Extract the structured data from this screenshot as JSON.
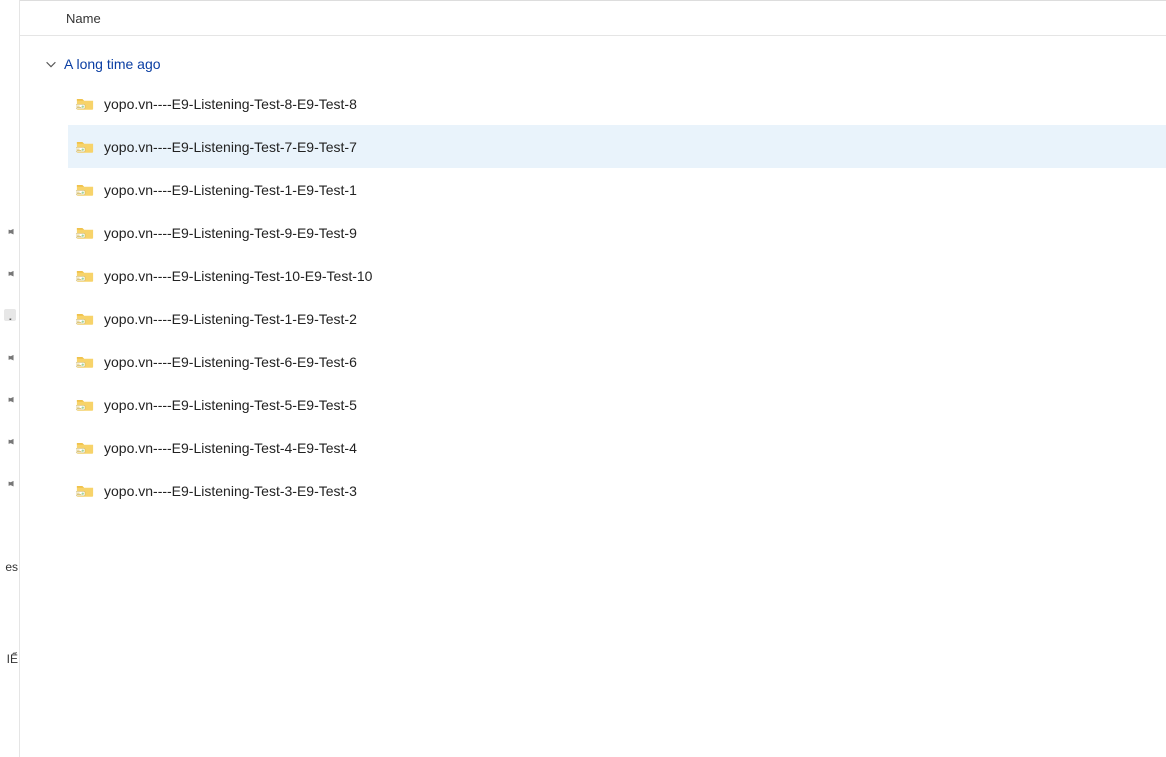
{
  "columns": {
    "name": "Name"
  },
  "group": {
    "label": "A long time ago",
    "expanded": true
  },
  "files": [
    {
      "name": "yopo.vn----E9-Listening-Test-8-E9-Test-8",
      "hovered": false
    },
    {
      "name": "yopo.vn----E9-Listening-Test-7-E9-Test-7",
      "hovered": true
    },
    {
      "name": "yopo.vn----E9-Listening-Test-1-E9-Test-1",
      "hovered": false
    },
    {
      "name": "yopo.vn----E9-Listening-Test-9-E9-Test-9",
      "hovered": false
    },
    {
      "name": "yopo.vn----E9-Listening-Test-10-E9-Test-10",
      "hovered": false
    },
    {
      "name": "yopo.vn----E9-Listening-Test-1-E9-Test-2",
      "hovered": false
    },
    {
      "name": "yopo.vn----E9-Listening-Test-6-E9-Test-6",
      "hovered": false
    },
    {
      "name": "yopo.vn----E9-Listening-Test-5-E9-Test-5",
      "hovered": false
    },
    {
      "name": "yopo.vn----E9-Listening-Test-4-E9-Test-4",
      "hovered": false
    },
    {
      "name": "yopo.vn----E9-Listening-Test-3-E9-Test-3",
      "hovered": false
    }
  ],
  "side_labels": {
    "item1": "es",
    "item2": "IỂ"
  }
}
